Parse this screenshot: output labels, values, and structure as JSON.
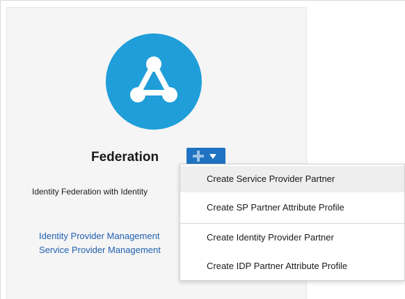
{
  "card": {
    "title": "Federation",
    "description": "Identity Federation with Identity",
    "links": [
      "Identity Provider Management",
      "Service Provider Management"
    ],
    "logo_icon": "federation-triangle-icon",
    "logo_color": "#1f9ed9"
  },
  "add_button": {
    "icons": [
      "plus-icon",
      "caret-down-icon"
    ],
    "color": "#1f73c2"
  },
  "dropdown_menu": {
    "items": [
      "Create Service Provider Partner",
      "Create SP Partner Attribute Profile",
      "Create Identity Provider Partner",
      "Create IDP Partner Attribute Profile"
    ],
    "highlighted_item": "Create Service Provider Partner"
  }
}
